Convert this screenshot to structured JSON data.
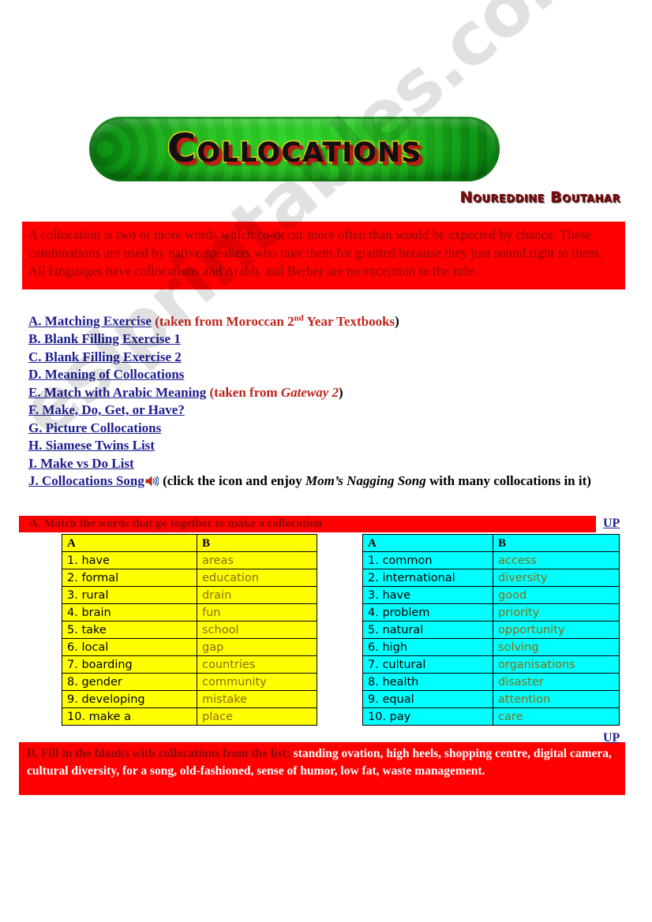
{
  "title": "Collocations",
  "author": "Noureddine Boutahar",
  "watermark": "eslprintables.com",
  "definition": "  A collocation is two or more words which co-occur more often than would be expected by chance. These combinations are used by native speakers who take them for granted because they just sound right to them. All languages have collocations and Arabic and Berber are no exception to the rule.",
  "links": [
    {
      "label": "A. Matching Exercise",
      "note_pre": " (taken from Moroccan 2",
      "note_sup": "nd",
      "note_post": " Year Textbooks",
      "note_close": ")"
    },
    {
      "label": "B. Blank Filling Exercise 1"
    },
    {
      "label": "C. Blank Filling Exercise 2"
    },
    {
      "label": "D. Meaning of Collocations"
    },
    {
      "label": "E. Match with Arabic Meaning",
      "note_pre": " (taken from ",
      "note_italic": "Gateway 2",
      "note_close": ")"
    },
    {
      "label": "F. Make, Do, Get, or Have?"
    },
    {
      "label": "G. Picture Collocations"
    },
    {
      "label": "H. Siamese Twins List"
    },
    {
      "label": "I. Make vs Do List"
    },
    {
      "label": "J. Collocations Song",
      "icon": "speaker-icon",
      "black_pre": " (click the icon and enjoy ",
      "black_italic": "Mom’s Nagging Song",
      "black_post": " with many collocations in it)"
    }
  ],
  "section_a": {
    "heading": "A.  Match the words that go together to make a collocation",
    "up_label": "UP",
    "table_left": {
      "headers": [
        "A",
        "B"
      ],
      "rows": [
        [
          "1. have",
          "areas"
        ],
        [
          "2. formal",
          "education"
        ],
        [
          "3. rural",
          "drain"
        ],
        [
          "4. brain",
          "fun"
        ],
        [
          "5. take",
          "school"
        ],
        [
          "6. local",
          "gap"
        ],
        [
          "7. boarding",
          "countries"
        ],
        [
          "8. gender",
          "community"
        ],
        [
          "9. developing",
          "mistake"
        ],
        [
          "10. make a",
          "place"
        ]
      ]
    },
    "table_right": {
      "headers": [
        "A",
        "B"
      ],
      "rows": [
        [
          "1. common",
          "access"
        ],
        [
          "2. international",
          "diversity"
        ],
        [
          "3. have",
          "good"
        ],
        [
          "4. problem",
          "priority"
        ],
        [
          "5. natural",
          "opportunity"
        ],
        [
          "6. high",
          "solving"
        ],
        [
          "7. cultural",
          "organisations"
        ],
        [
          "8. health",
          "disaster"
        ],
        [
          "9. equal",
          "attention"
        ],
        [
          "10. pay",
          "care"
        ]
      ]
    }
  },
  "section_b": {
    "up_label": "UP",
    "heading": " B. Fill in the blanks with collocations from the list:",
    "word_list": " standing ovation, high heels, shopping centre, digital camera, cultural diversity, for a song, old-fashioned, sense of humor, low fat, waste management."
  },
  "colors": {
    "red_box": "#fe0000",
    "link_blue": "#1d1d8f",
    "note_red": "#c0251b",
    "table_yellow": "#ffff00",
    "table_cyan": "#00ffff",
    "col_b_text": "#8a6a14",
    "banner_green": "#24b81f",
    "author_dark_red": "#7b0d0d"
  }
}
